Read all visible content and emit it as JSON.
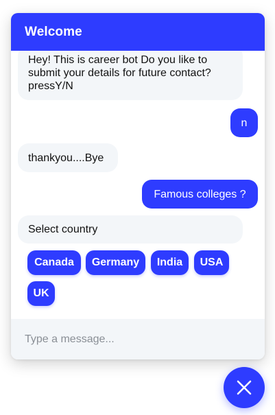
{
  "header": {
    "title": "Welcome"
  },
  "messages": [
    {
      "from": "bot",
      "text": "Hey! This is career bot Do you like to submit your details for future contact? pressY/N"
    },
    {
      "from": "user",
      "text": "n"
    },
    {
      "from": "bot",
      "text": "thankyou....Bye"
    },
    {
      "from": "user",
      "text": "Famous colleges ?"
    },
    {
      "from": "bot",
      "text": "Select country"
    }
  ],
  "options": [
    "Canada",
    "Germany",
    "India",
    "USA",
    "UK"
  ],
  "composer": {
    "placeholder": "Type a message..."
  },
  "fab": {
    "icon": "close-icon"
  },
  "colors": {
    "accent": "#2e3cff",
    "bot_bubble": "#f3f6f9"
  }
}
